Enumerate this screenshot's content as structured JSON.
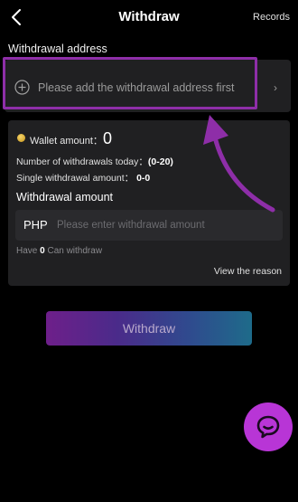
{
  "header": {
    "title": "Withdraw",
    "records_label": "Records"
  },
  "address": {
    "section_label": "Withdrawal address",
    "placeholder": "Please add the withdrawal address first",
    "chevron": "›"
  },
  "wallet": {
    "label": "Wallet amount：",
    "value": "0"
  },
  "limits": {
    "count_label": "Number of withdrawals today：",
    "count_value": "(0-20)",
    "single_label": "Single withdrawal amount： ",
    "single_value": "0-0"
  },
  "amount": {
    "label": "Withdrawal amount",
    "currency": "PHP",
    "placeholder": "Please enter withdrawal amount",
    "value": ""
  },
  "can_withdraw": {
    "prefix": "Have ",
    "value": "0",
    "suffix": " Can withdraw"
  },
  "view_reason_label": "View the reason",
  "withdraw_button_label": "Withdraw",
  "icons": {
    "back": "chevron-left-icon",
    "add": "plus-circle-icon",
    "coin": "coin-icon",
    "chat": "chat-bubble-icon"
  },
  "colors": {
    "highlight": "#8e2ea8",
    "chat_button": "#b835d6",
    "card_bg": "#202022",
    "page_bg": "#000000"
  }
}
